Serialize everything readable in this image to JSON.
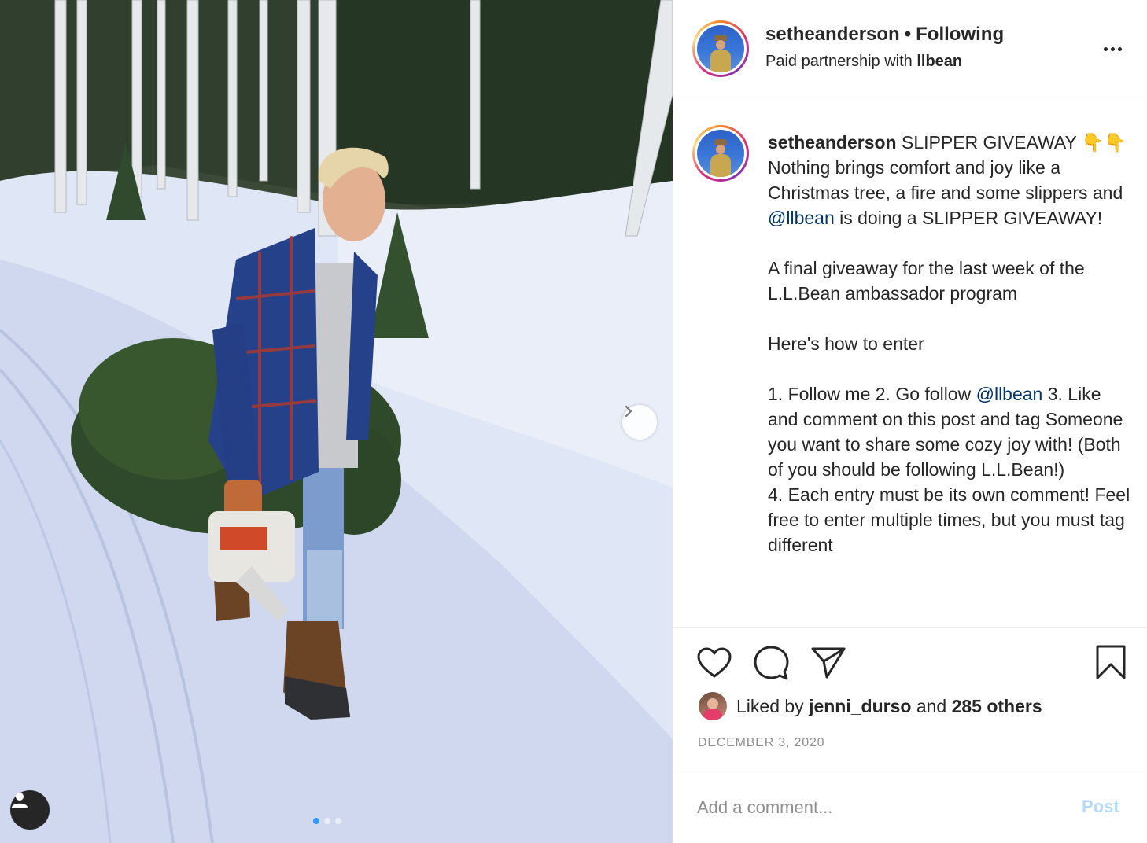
{
  "post": {
    "username": "setheanderson",
    "separator": "•",
    "follow_status": "Following",
    "partnership_prefix": "Paid partnership with",
    "partner": "llbean",
    "more_icon": "more-horizontal-icon"
  },
  "caption": {
    "username": "setheanderson",
    "line_intro": " SLIPPER GIVEAWAY 👇👇\nNothing brings comfort and joy like a Christmas tree, a fire and some slippers and ",
    "mention_1": "@llbean",
    "line_after_mention_1": " is doing a SLIPPER GIVEAWAY!\n\nA final giveaway for the last week of the L.L.Bean ambassador program\n\nHere's how to enter\n\n1. Follow me 2. Go follow ",
    "mention_2": "@llbean",
    "line_after_mention_2": " 3. Like and comment on this post and tag Someone you want to share some cozy joy with! (Both of you should be following L.L.Bean!)\n4. Each entry must be its own comment! Feel free to enter multiple times, but you must tag different"
  },
  "actions": {
    "like_icon": "heart-icon",
    "comment_icon": "comment-bubble-icon",
    "share_icon": "paper-plane-icon",
    "save_icon": "bookmark-icon"
  },
  "likes": {
    "prefix": "Liked by",
    "user": "jenni_durso",
    "conjunction": "and",
    "others": "285 others"
  },
  "date": "DECEMBER 3, 2020",
  "comment": {
    "placeholder": "Add a comment...",
    "post_label": "Post"
  },
  "carousel": {
    "slide_count": 3,
    "active_index": 0
  },
  "colors": {
    "mention": "#003569",
    "post_disabled": "#b3dbff",
    "carousel_active": "#3897f0"
  }
}
